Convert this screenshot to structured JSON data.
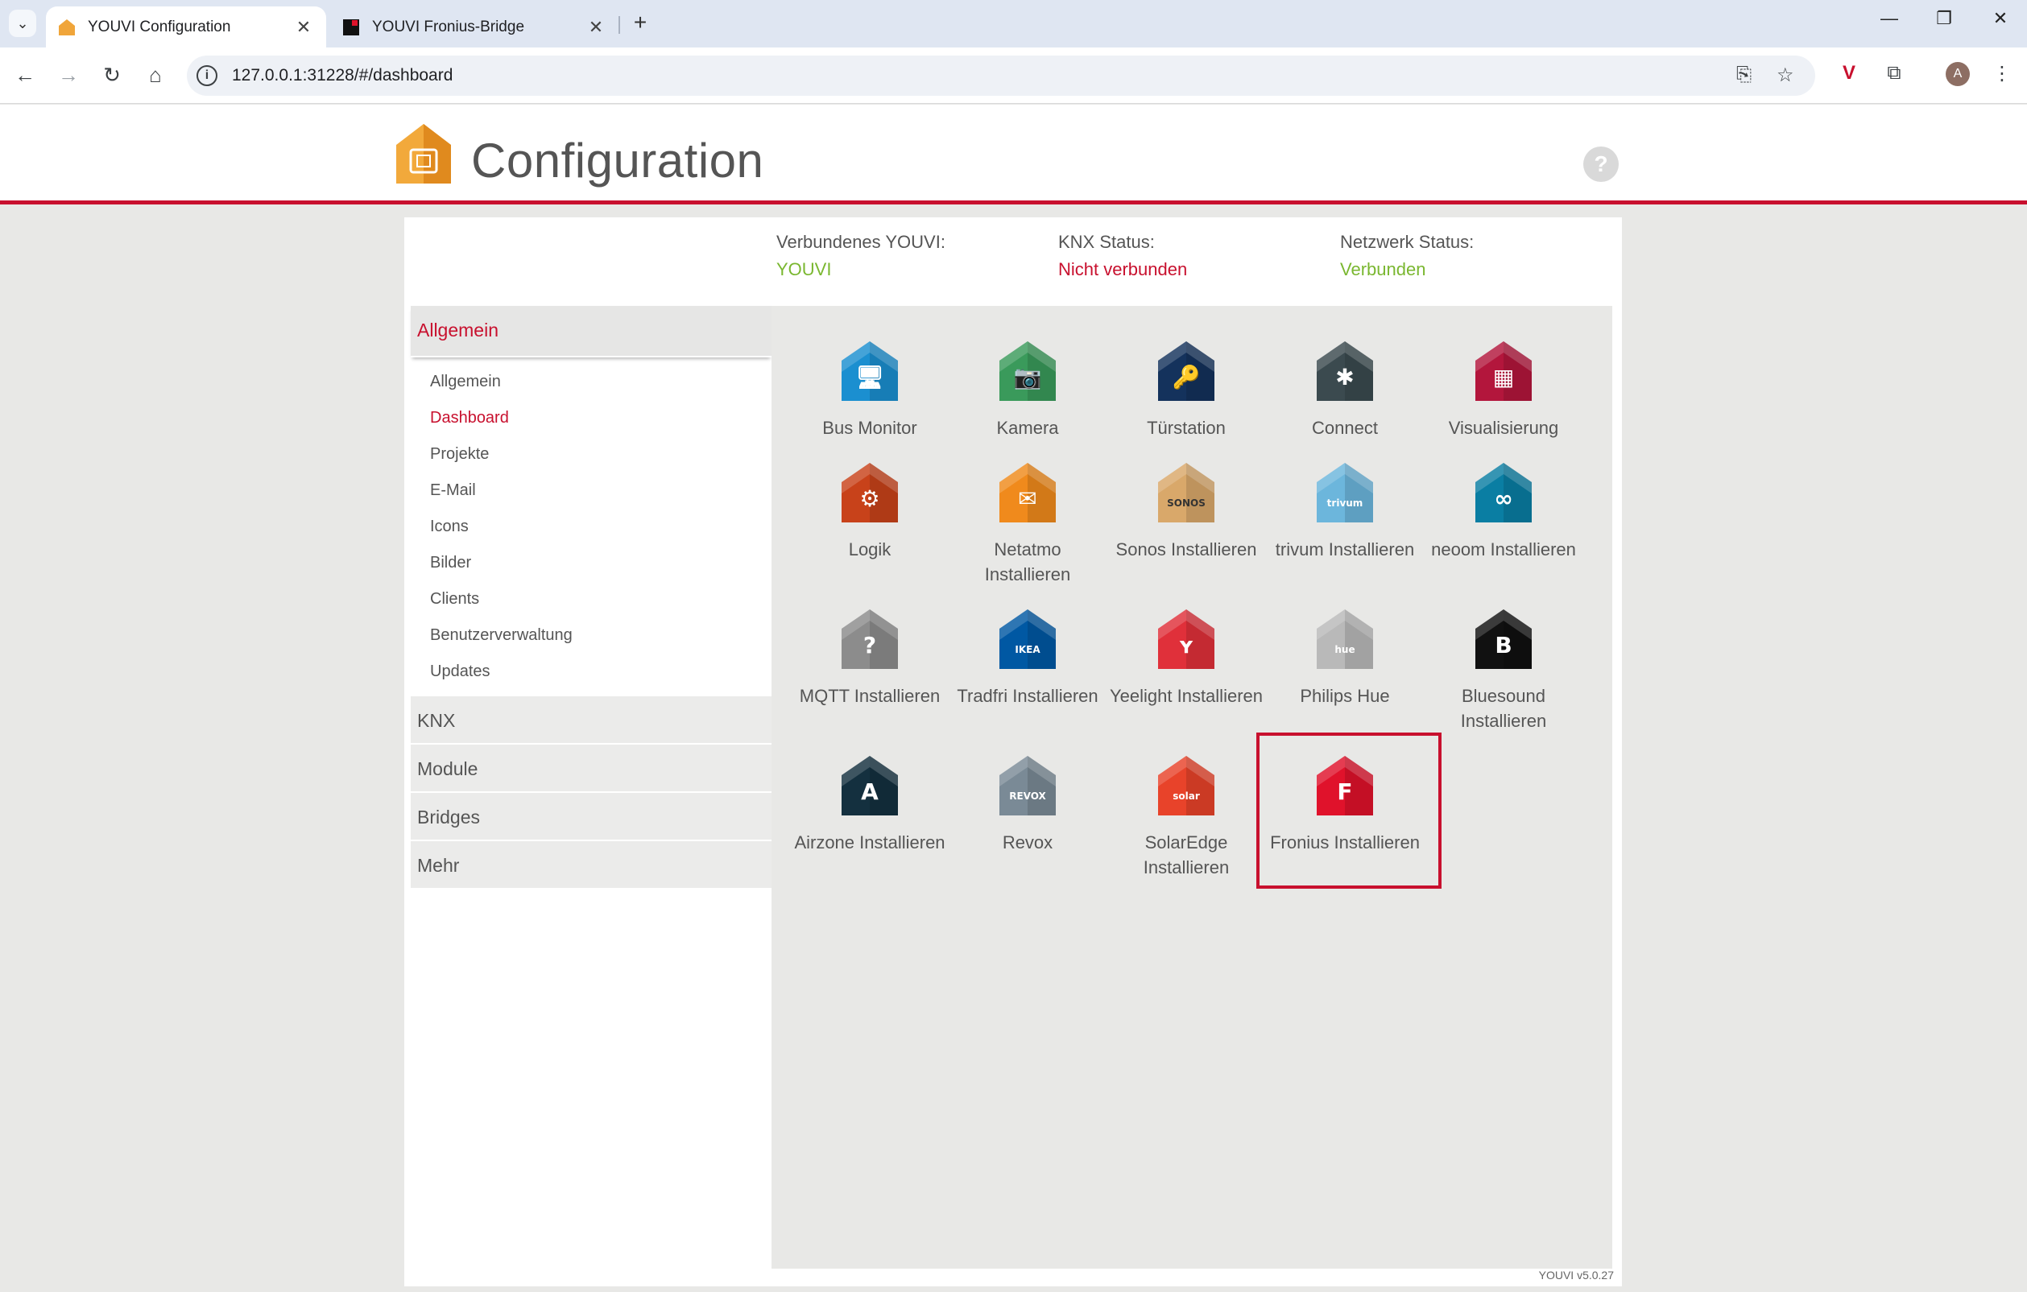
{
  "browser": {
    "tabs": [
      {
        "title": "YOUVI Configuration",
        "active": true
      },
      {
        "title": "YOUVI Fronius-Bridge",
        "active": false
      }
    ],
    "url": "127.0.0.1:31228/#/dashboard",
    "profile_initial": "A"
  },
  "header": {
    "title": "Configuration",
    "help": "?"
  },
  "status": {
    "youvi_label": "Verbundenes YOUVI:",
    "youvi_value": "YOUVI",
    "knx_label": "KNX Status:",
    "knx_value": "Nicht verbunden",
    "network_label": "Netzwerk Status:",
    "network_value": "Verbunden"
  },
  "sidebar": {
    "sections": [
      {
        "label": "Allgemein",
        "open": true,
        "items": [
          "Allgemein",
          "Dashboard",
          "Projekte",
          "E-Mail",
          "Icons",
          "Bilder",
          "Clients",
          "Benutzerverwaltung",
          "Updates"
        ],
        "active_item": "Dashboard"
      },
      {
        "label": "KNX"
      },
      {
        "label": "Module"
      },
      {
        "label": "Bridges"
      },
      {
        "label": "Mehr"
      }
    ]
  },
  "tiles": [
    {
      "label": "Bus Monitor",
      "color": "#1b8fd0",
      "glyph": "🖥"
    },
    {
      "label": "Kamera",
      "color": "#3a9a5b",
      "glyph": "📷"
    },
    {
      "label": "Türstation",
      "color": "#14325c",
      "glyph": "🔑"
    },
    {
      "label": "Connect",
      "color": "#3b4a4f",
      "glyph": "✱"
    },
    {
      "label": "Visualisierung",
      "color": "#b3163c",
      "glyph": "▦"
    },
    {
      "label": "Logik",
      "color": "#c8421a",
      "glyph": "⚙"
    },
    {
      "label": "Netatmo Installieren",
      "color": "#f08a1c",
      "glyph": "✉"
    },
    {
      "label": "Sonos Installieren",
      "color": "#d9a86a",
      "glyph": "SONOS"
    },
    {
      "label": "trivum Installieren",
      "color": "#6cb6dc",
      "glyph": "trivum"
    },
    {
      "label": "neoom Installieren",
      "color": "#0a7ea3",
      "glyph": "∞"
    },
    {
      "label": "MQTT Installieren",
      "color": "#8c8c8c",
      "glyph": "?"
    },
    {
      "label": "Tradfri Installieren",
      "color": "#0058a3",
      "glyph": "IKEA"
    },
    {
      "label": "Yeelight Installieren",
      "color": "#e0303a",
      "glyph": "ʏ"
    },
    {
      "label": "Philips Hue",
      "color": "#b9b9b9",
      "glyph": "hue"
    },
    {
      "label": "Bluesound Installieren",
      "color": "#111111",
      "glyph": "B"
    },
    {
      "label": "Airzone Installieren",
      "color": "#14303f",
      "glyph": "A"
    },
    {
      "label": "Revox",
      "color": "#7a8a96",
      "glyph": "REVOX"
    },
    {
      "label": "SolarEdge Installieren",
      "color": "#e8432a",
      "glyph": "solar"
    },
    {
      "label": "Fronius Installieren",
      "color": "#e0122b",
      "glyph": "F"
    }
  ],
  "version": "YOUVI v5.0.27"
}
